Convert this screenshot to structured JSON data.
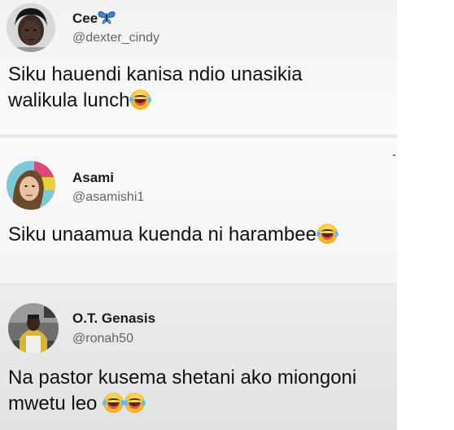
{
  "tweets": [
    {
      "name": "Cee",
      "name_icon": "butterfly-icon",
      "handle": "@dexter_cindy",
      "text_lines": [
        "Siku hauendi kanisa ndio unasikia",
        "walikula lunch"
      ],
      "emoji": [
        "laughing-emoji"
      ]
    },
    {
      "name": "Asami",
      "handle": "@asamishi1",
      "text_lines": [
        "Siku unaamua kuenda ni harambee"
      ],
      "emoji": [
        "laughing-emoji"
      ]
    },
    {
      "name": "O.T. Genasis",
      "handle": "@ronah50",
      "text_lines": [
        "Na pastor kusema shetani ako miongoni",
        "mwetu leo"
      ],
      "emoji": [
        "laughing-emoji",
        "laughing-emoji"
      ]
    }
  ],
  "colors": {
    "name": "#1a1a1a",
    "handle": "#5b6670",
    "butterfly": "#3b82d6",
    "emoji": "#f5b323"
  }
}
